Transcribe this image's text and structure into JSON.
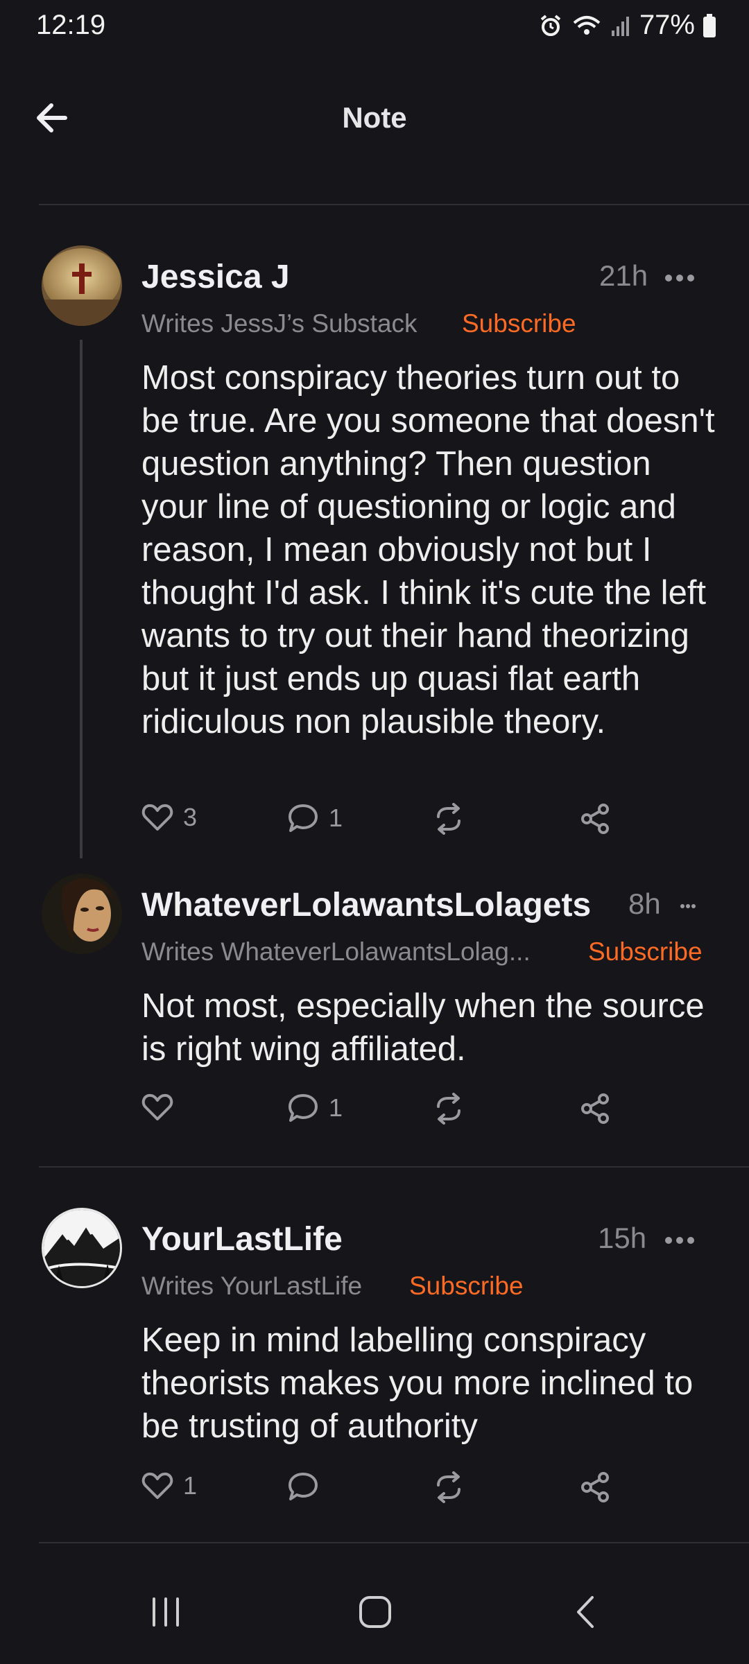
{
  "status": {
    "time": "12:19",
    "battery": "77%"
  },
  "header": {
    "title": "Note"
  },
  "notes": [
    {
      "author": "Jessica J",
      "time": "21h",
      "writes": "Writes JessJ’s Substack",
      "subscribe": "Subscribe",
      "body": "Most conspiracy theories turn out to be true. Are you someone that doesn't question anything? Then question your line of questioning or logic and reason, I mean obviously not but I thought I'd ask. I think it's cute the left wants to try out their hand theorizing but it just ends up quasi flat earth ridiculous non plausible theory.",
      "likes": "3",
      "comments": "1"
    },
    {
      "author": "WhateverLolawantsLolagets",
      "time": "8h",
      "writes": "Writes WhateverLolawantsLolag...",
      "subscribe": "Subscribe",
      "body": "Not most, especially when the source is right wing affiliated.",
      "likes": "",
      "comments": "1"
    },
    {
      "author": "YourLastLife",
      "time": "15h",
      "writes": "Writes YourLastLife",
      "subscribe": "Subscribe",
      "body": "Keep in mind labelling conspiracy theorists makes you more inclined to be trusting of authority",
      "likes": "1",
      "comments": ""
    }
  ],
  "icons": {
    "back": "arrow-left-icon",
    "more": "more-dots-icon",
    "like": "heart-icon",
    "comment": "comment-bubble-icon",
    "restack": "restack-icon",
    "share": "share-icon",
    "nav_recents": "recents-icon",
    "nav_home": "home-icon",
    "nav_back": "chevron-left-icon"
  },
  "colors": {
    "accent": "#ff6a24",
    "background": "#16161a",
    "muted": "#8a8a90"
  }
}
